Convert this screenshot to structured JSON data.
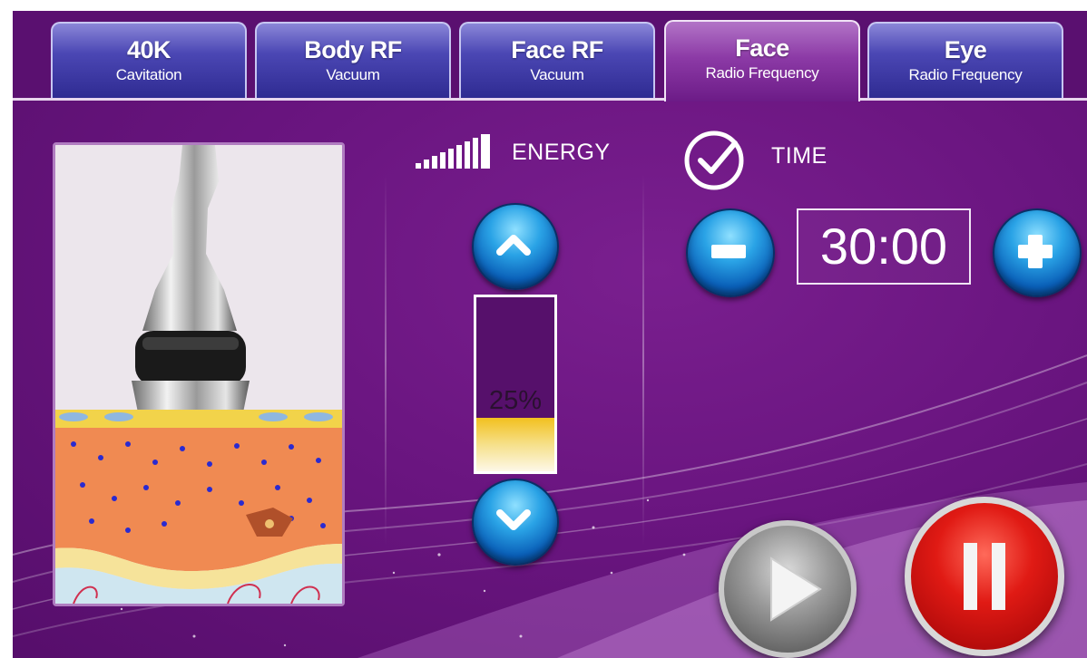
{
  "tabs": [
    {
      "title": "40K",
      "subtitle": "Cavitation"
    },
    {
      "title": "Body RF",
      "subtitle": "Vacuum"
    },
    {
      "title": "Face RF",
      "subtitle": "Vacuum"
    },
    {
      "title": "Face",
      "subtitle": "Radio Frequency",
      "active": true
    },
    {
      "title": "Eye",
      "subtitle": "Radio Frequency"
    }
  ],
  "energy": {
    "label": "ENERGY",
    "level_text": "25%",
    "level": 0.25
  },
  "time": {
    "label": "TIME",
    "value": "30:00"
  },
  "icons": {
    "energy": "signal-bars-icon",
    "time": "checkmark-circle-icon",
    "up": "chevron-up-icon",
    "down": "chevron-down-icon",
    "minus": "minus-icon",
    "plus": "plus-icon",
    "play": "play-icon",
    "pause": "pause-icon"
  },
  "colors": {
    "background": "#6a1580",
    "tab": "#4b47b4",
    "active_tab": "#8c3aa6",
    "energy_fill": "#f2c01e",
    "pause": "#e01a14"
  }
}
